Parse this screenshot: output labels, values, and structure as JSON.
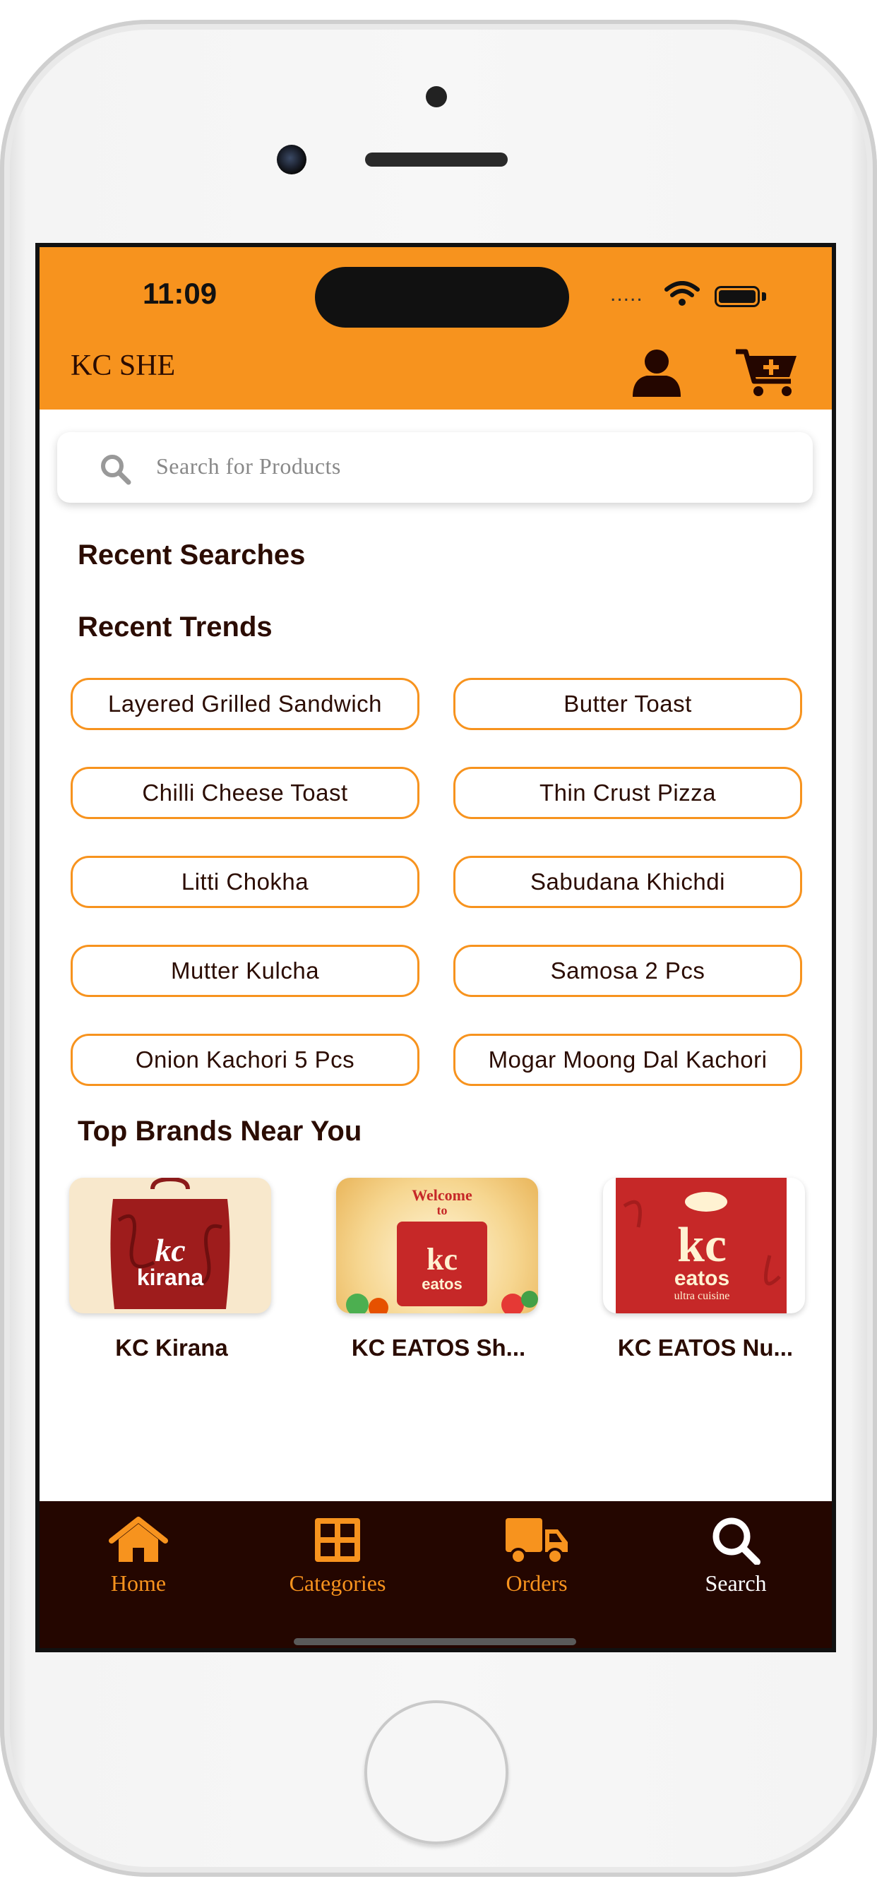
{
  "status_bar": {
    "time": "11:09",
    "signal": "....."
  },
  "header": {
    "app_title": "KC SHE",
    "profile_icon": "user-icon",
    "cart_icon": "cart-plus-icon"
  },
  "search": {
    "placeholder": "Search for Products",
    "icon": "search-icon"
  },
  "recent_searches": {
    "title": "Recent Searches"
  },
  "recent_trends": {
    "title": "Recent Trends",
    "items": [
      "Layered Grilled Sandwich",
      "Butter Toast",
      "Chilli Cheese Toast",
      "Thin Crust Pizza",
      "Litti Chokha",
      "Sabudana Khichdi",
      "Mutter Kulcha",
      "Samosa 2 Pcs",
      "Onion Kachori 5 Pcs",
      "Mogar Moong Dal Kachori"
    ]
  },
  "top_brands": {
    "title": "Top Brands Near You",
    "brands": [
      {
        "name": "KC Kirana",
        "logo_text": "kc kirana"
      },
      {
        "name": "KC EATOS Sh...",
        "logo_text": "Welcome to kc eatos"
      },
      {
        "name": "KC EATOS Nu...",
        "logo_text": "kc eatos ultra cuisine"
      }
    ]
  },
  "bottom_nav": {
    "items": [
      {
        "label": "Home",
        "icon": "home-icon",
        "active": false
      },
      {
        "label": "Categories",
        "icon": "grid-icon",
        "active": false
      },
      {
        "label": "Orders",
        "icon": "truck-icon",
        "active": false
      },
      {
        "label": "Search",
        "icon": "search-icon",
        "active": true
      }
    ]
  },
  "colors": {
    "accent": "#f7931e",
    "dark": "#240600",
    "text": "#2b0c02"
  }
}
